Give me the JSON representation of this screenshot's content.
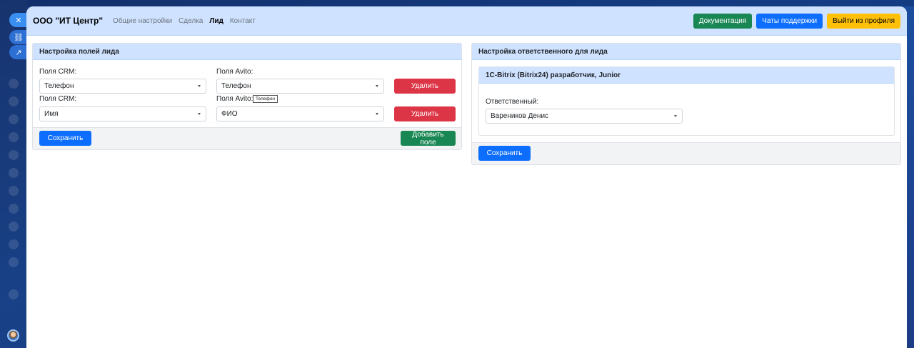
{
  "nav": {
    "brand": "ООО \"ИТ Центр\"",
    "links": [
      "Общие настройки",
      "Сделка",
      "Лид",
      "Контакт"
    ],
    "active": "Лид",
    "buttons": {
      "docs": "Документация",
      "support": "Чаты поддержки",
      "logout": "Выйти из профиля"
    }
  },
  "lead_fields": {
    "title": "Настройка полей лида",
    "rows": [
      {
        "crm_label": "Поля CRM:",
        "crm_value": "Телефон",
        "avito_label": "Поля Avito:",
        "avito_value": "Телефон",
        "delete": "Удалить"
      },
      {
        "crm_label": "Поля CRM:",
        "crm_value": "Имя",
        "avito_label": "Поля Avito:",
        "avito_value": "ФИО",
        "delete": "Удалить"
      }
    ],
    "tooltip": "Телефон",
    "save": "Сохранить",
    "add": "Добавить поле"
  },
  "responsible": {
    "title": "Настройка ответственного для лида",
    "inner_title": "1С-Bitrix (Bitrix24) разработчик, Junior",
    "label": "Ответственный:",
    "value": "Вареников Денис",
    "save": "Сохранить"
  },
  "colors": {
    "header_bg": "#cfe2ff",
    "primary": "#0d6efd",
    "success": "#198754",
    "danger": "#dc3545",
    "warning": "#ffc107"
  }
}
